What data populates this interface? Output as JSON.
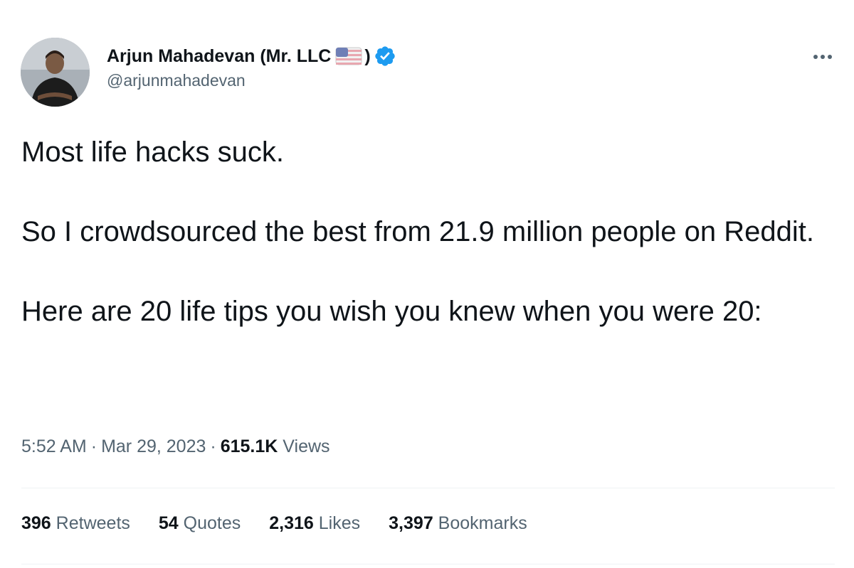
{
  "author": {
    "display_name": "Arjun Mahadevan (Mr. LLC",
    "display_name_close": ")",
    "handle": "@arjunmahadevan",
    "avatar_icon": "avatar-photo",
    "flag_icon": "us-flag-icon",
    "verified_icon": "verified-badge-icon",
    "verified_color": "#1d9bf0"
  },
  "tweet": {
    "paragraphs": [
      "Most life hacks suck.",
      "So I crowdsourced the best from 21.9 million people on Reddit.",
      "Here are 20 life tips you wish you knew when you were 20:"
    ],
    "time": "5:52 AM",
    "date": "Mar 29, 2023",
    "views_count": "615.1K",
    "views_label": "Views",
    "separator": "·"
  },
  "stats": [
    {
      "count": "396",
      "label": "Retweets"
    },
    {
      "count": "54",
      "label": "Quotes"
    },
    {
      "count": "2,316",
      "label": "Likes"
    },
    {
      "count": "3,397",
      "label": "Bookmarks"
    }
  ],
  "colors": {
    "text_primary": "#0f1419",
    "text_secondary": "#536471",
    "divider": "#eff3f4",
    "accent": "#1d9bf0"
  }
}
